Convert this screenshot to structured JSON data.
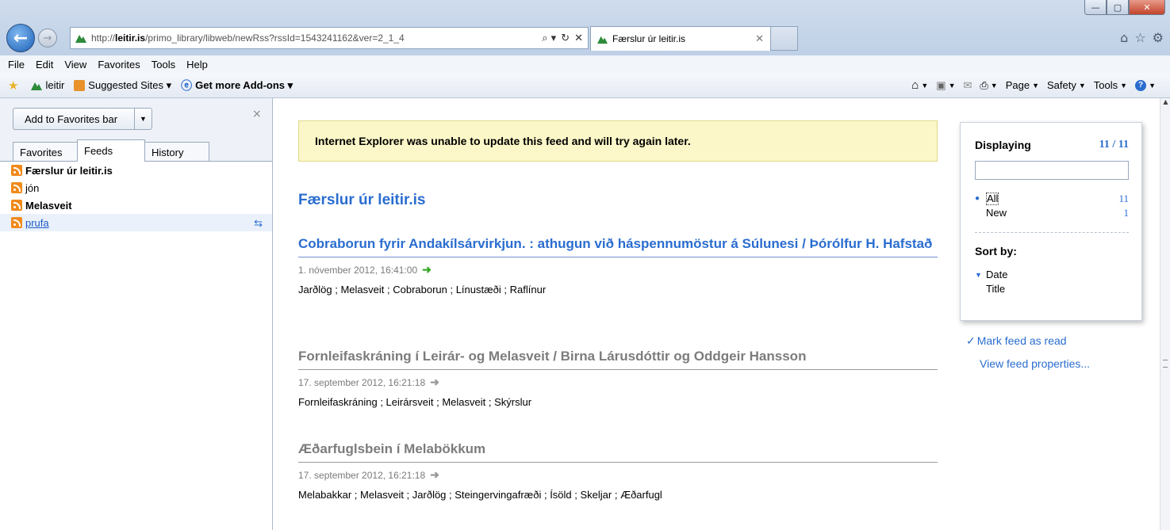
{
  "window": {
    "controls": {
      "minimize": "—",
      "maximize": "▢",
      "close": "✕"
    }
  },
  "address": {
    "url_prefix": "http://",
    "url_domain": "leitir.is",
    "url_path": "/primo_library/libweb/newRss?rssId=1543241162&ver=2_1_4",
    "search_glyph": "⌕ ▾",
    "refresh_glyph": "↻",
    "stop_glyph": "✕"
  },
  "tab": {
    "label": "Færslur úr leitir.is",
    "close": "✕"
  },
  "menu": [
    "File",
    "Edit",
    "View",
    "Favorites",
    "Tools",
    "Help"
  ],
  "favorites_bar": {
    "items": [
      {
        "label": "leitir",
        "icon": "leitir-icon"
      },
      {
        "label": "Suggested Sites ▾",
        "icon": "suggested-sites-icon"
      },
      {
        "label": "Get more Add-ons ▾",
        "icon": "ie-addons-icon"
      }
    ]
  },
  "command_bar": {
    "page": "Page",
    "safety": "Safety",
    "tools": "Tools"
  },
  "sidebar": {
    "add_favorites": "Add to Favorites bar",
    "close": "×",
    "tabs": [
      "Favorites",
      "Feeds",
      "History"
    ],
    "active_tab": "Feeds",
    "feeds": [
      {
        "label": "Færslur úr leitir.is",
        "bold": true
      },
      {
        "label": "jón",
        "bold": false
      },
      {
        "label": "Melasveit",
        "bold": true
      },
      {
        "label": "prufa",
        "bold": false,
        "link": true
      }
    ]
  },
  "main": {
    "warning": "Internet Explorer was unable to update this feed and will try again later.",
    "feed_title": "Færslur úr leitir.is",
    "entries": [
      {
        "title": "Cobraborun fyrir Andakílsárvirkjun. : athugun við háspennumöstur á Súlunesi / Þórólfur H. Hafstað",
        "date": "1. nóvember 2012, 16:41:00",
        "tags": "Jarðlög ; Melasveit ; Cobraborun ; Línustæði ; Raflínur",
        "unread": true
      },
      {
        "title": "Fornleifaskráning í Leirár- og Melasveit / Birna Lárusdóttir og Oddgeir Hansson",
        "date": "17. september 2012, 16:21:18",
        "tags": "Fornleifaskráning ; Leirársveit ; Melasveit ; Skýrslur",
        "unread": false
      },
      {
        "title": "Æðarfuglsbein í Melabökkum",
        "date": "17. september 2012, 16:21:18",
        "tags": "Melabakkar ; Melasveit ; Jarðlög ; Steingervingafræði ; Ísöld ; Skeljar ; Æðarfugl",
        "unread": false
      }
    ]
  },
  "filter": {
    "displaying_label": "Displaying",
    "displaying_count": "11 / 11",
    "search_value": "",
    "options": [
      {
        "label": "All",
        "count": "11",
        "selected": true
      },
      {
        "label": "New",
        "count": "1",
        "selected": false
      }
    ],
    "sort_label": "Sort by:",
    "sort_options": [
      {
        "label": "Date",
        "selected": true
      },
      {
        "label": "Title",
        "selected": false
      }
    ]
  },
  "feed_actions": {
    "mark_read": "Mark feed as read",
    "properties": "View feed properties..."
  },
  "colors": {
    "link_blue": "#2a6dcf",
    "warning_bg": "#fbf7c8",
    "rss_orange": "#f08a1c",
    "unread_arrow": "#3aa829"
  }
}
